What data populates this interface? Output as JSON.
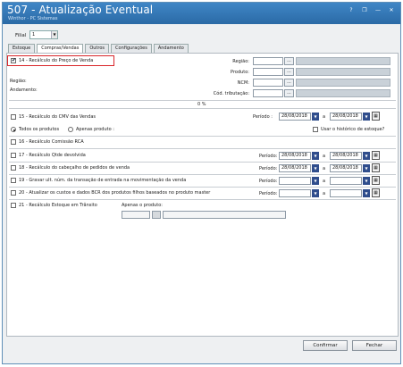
{
  "window": {
    "title": "507 - Atualização Eventual",
    "subtitle": "Winthor - PC Sistemas",
    "controls": [
      "?",
      "❐",
      "—",
      "✕"
    ]
  },
  "filial": {
    "label": "Filial",
    "value": "1"
  },
  "tabs": [
    "Estoque",
    "Compras/Vendas",
    "Outros",
    "Configurações",
    "Andamento"
  ],
  "active_tab": "Compras/Vendas",
  "section14": {
    "label": "14 - Recálculo do Preço de Venda",
    "checked": true,
    "fields": {
      "regiao": "Região:",
      "produto": "Produto:",
      "ncm": "NCM:",
      "cod_tributacao": "Cód. tributação:",
      "ellipsis": "..."
    },
    "regiao_status": "Região:",
    "andamento": "Andamento:",
    "progress": "0 %"
  },
  "section15": {
    "label": "15 - Recálculo do CMV das Vendas",
    "periodo": "Período :",
    "date_from": "28/08/2018",
    "a": "a",
    "date_to": "28/08/2018",
    "todos": "Todos os produtos",
    "apenas": "Apenas produto :",
    "usar_historico": "Usar o histórico de estoque?"
  },
  "section16": {
    "label": "16 - Recálculo Comissão RCA"
  },
  "section17": {
    "label": "17 - Recálculo Qtde devolvida",
    "periodo": "Período:",
    "date_from": "28/08/2018",
    "a": "a",
    "date_to": "28/08/2018"
  },
  "section18": {
    "label": "18 - Recálculo do cabeçalho de pedidos de venda",
    "periodo": "Período:",
    "date_from": "28/08/2018",
    "a": "a",
    "date_to": "28/08/2018"
  },
  "section19": {
    "label": "19 - Gravar ult. núm. da transação de entrada na movimentação da venda",
    "periodo": "Período:",
    "a": "a"
  },
  "section20": {
    "label": "20 - Atualizar os custos e dados BCR dos produtos filhos baseados no produto master",
    "periodo": "Período:",
    "a": "a"
  },
  "section21": {
    "label": "21 - Recálculo Estoque em Trânsito",
    "apenas": "Apenas o produto:"
  },
  "buttons": {
    "confirmar": "Confirmar",
    "fechar": "Fechar"
  },
  "colors": {
    "titlebar": "#2f74b5",
    "highlight": "#d9262a",
    "dropdown": "#2f4d8c"
  }
}
